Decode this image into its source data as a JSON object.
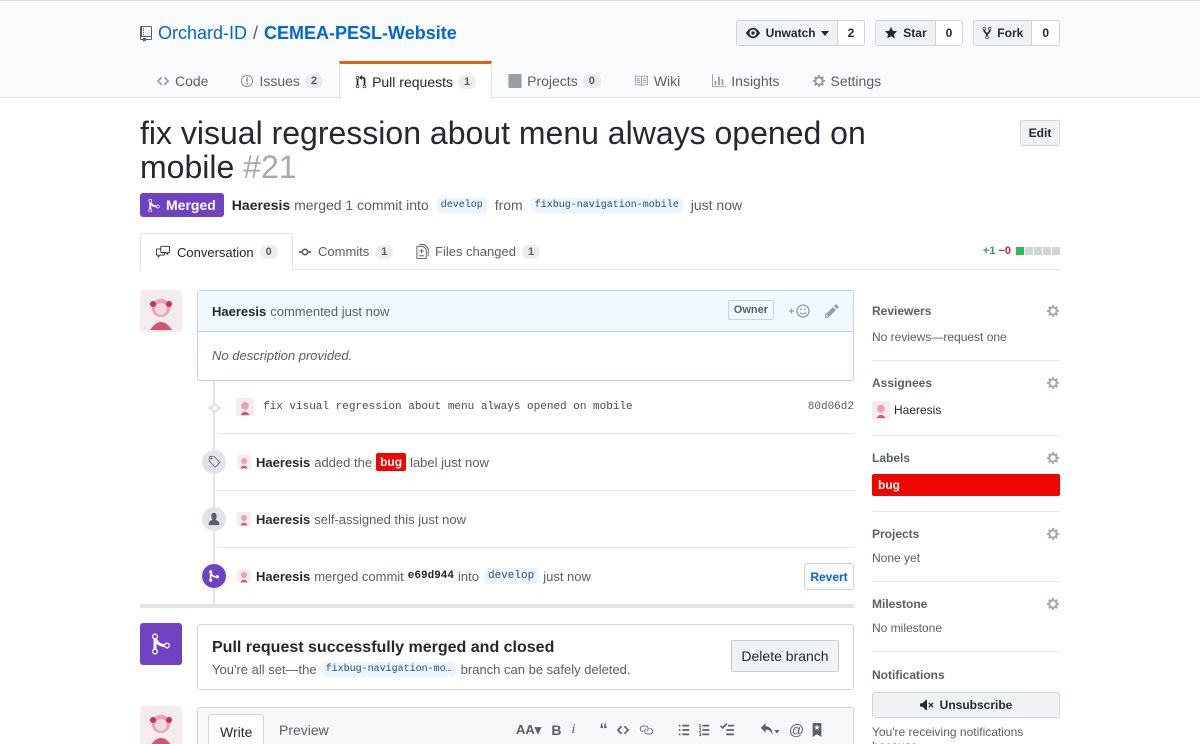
{
  "repo": {
    "owner": "Orchard-ID",
    "separator": "/",
    "name": "CEMEA-PESL-Website",
    "actions": {
      "watch_label": "Unwatch",
      "watch_count": "2",
      "star_label": "Star",
      "star_count": "0",
      "fork_label": "Fork",
      "fork_count": "0"
    }
  },
  "nav": {
    "code": "Code",
    "issues": "Issues",
    "issues_count": "2",
    "pulls": "Pull requests",
    "pulls_count": "1",
    "projects": "Projects",
    "projects_count": "0",
    "wiki": "Wiki",
    "insights": "Insights",
    "settings": "Settings"
  },
  "pr": {
    "title": "fix visual regression about menu always opened on mobile",
    "number": "#21",
    "edit_label": "Edit",
    "state": "Merged",
    "author": "Haeresis",
    "merge_text": "merged 1 commit into",
    "base_branch": "develop",
    "from_text": "from",
    "head_branch": "fixbug-navigation-mobile",
    "time": "just now"
  },
  "tabs": {
    "conversation": "Conversation",
    "conversation_count": "0",
    "commits": "Commits",
    "commits_count": "1",
    "files": "Files changed",
    "files_count": "1",
    "additions": "+1",
    "deletions": "−0",
    "diff_squares_green": 1,
    "diff_squares_total": 5
  },
  "comment": {
    "author": "Haeresis",
    "action": "commented just now",
    "owner_badge": "Owner",
    "body": "No description provided."
  },
  "commit": {
    "message": "fix visual regression about menu always opened on mobile",
    "sha": "80d06d2"
  },
  "timeline": {
    "label_event": {
      "author": "Haeresis",
      "before": "added the",
      "label": "bug",
      "after": "label just now"
    },
    "assign_event": {
      "author": "Haeresis",
      "text": "self-assigned this just now"
    },
    "merge_event": {
      "author": "Haeresis",
      "before": "merged commit",
      "sha": "e69d944",
      "into": "into",
      "branch": "develop",
      "time": "just now",
      "revert_label": "Revert"
    }
  },
  "merge_box": {
    "title": "Pull request successfully merged and closed",
    "sub_before": "You're all set—the",
    "branch": "fixbug-navigation-mo…",
    "sub_after": "branch can be safely deleted.",
    "delete_label": "Delete branch"
  },
  "editor": {
    "write_tab": "Write",
    "preview_tab": "Preview"
  },
  "sidebar": {
    "reviewers_title": "Reviewers",
    "reviewers_value": "No reviews—request one",
    "assignees_title": "Assignees",
    "assignee": "Haeresis",
    "labels_title": "Labels",
    "label": "bug",
    "label_color": "#ee0701",
    "projects_title": "Projects",
    "projects_value": "None yet",
    "milestone_title": "Milestone",
    "milestone_value": "No milestone",
    "notifications_title": "Notifications",
    "unsubscribe_label": "Unsubscribe",
    "notif_note": "You're receiving notifications because"
  },
  "colors": {
    "link": "#0366d6",
    "merged": "#6f42c1",
    "bug": "#ee0701",
    "accent_tab": "#e36209"
  }
}
